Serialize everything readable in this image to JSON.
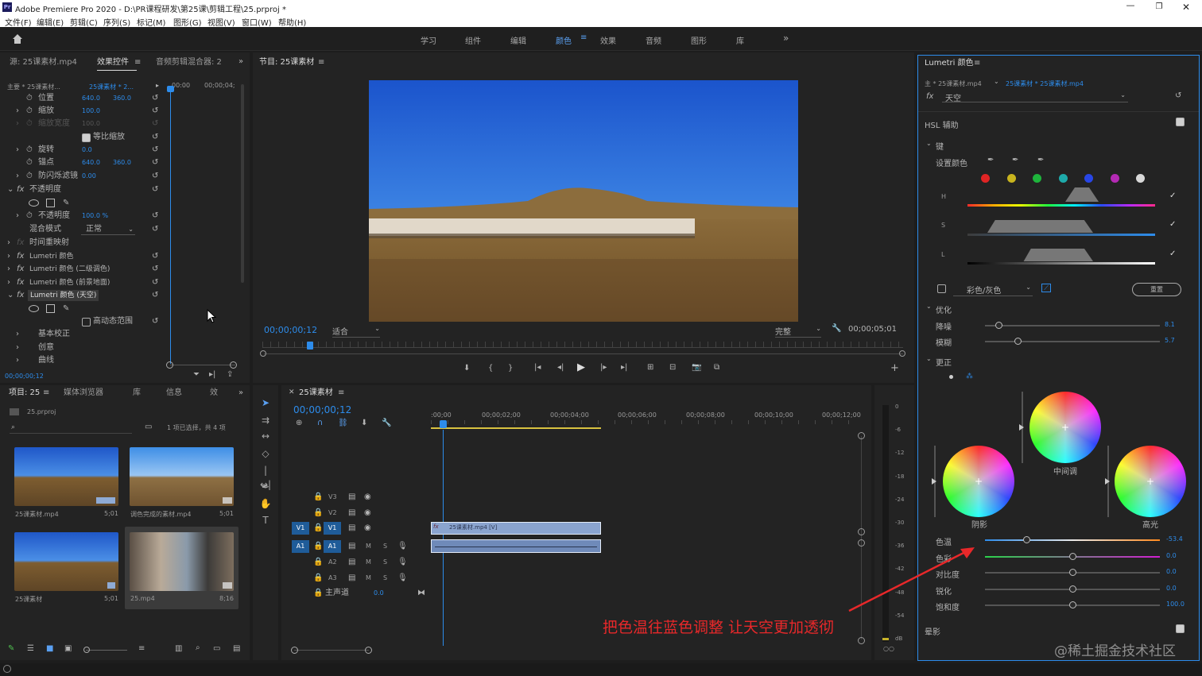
{
  "window": {
    "title": "Adobe Premiere Pro 2020 - D:\\PR课程研发\\第25课\\剪辑工程\\25.prproj *",
    "controls": [
      "minimize",
      "restore",
      "close"
    ]
  },
  "menu": [
    "文件(F)",
    "编辑(E)",
    "剪辑(C)",
    "序列(S)",
    "标记(M)",
    "图形(G)",
    "视图(V)",
    "窗口(W)",
    "帮助(H)"
  ],
  "workspaces": {
    "items": [
      "学习",
      "组件",
      "编辑",
      "颜色",
      "效果",
      "音频",
      "图形",
      "库"
    ],
    "active": "颜色"
  },
  "effect_controls": {
    "tabs": [
      "源: 25课素材.mp4",
      "效果控件",
      "音频剪辑混合器: 2"
    ],
    "active_tab": "效果控件",
    "clip_label": "主要 * 25课素材...",
    "clip_target": "25课素材 * 2...",
    "time_start": "00:00",
    "time_end": "00;00;04;",
    "rows": [
      {
        "name": "位置",
        "v1": "640.0",
        "v2": "360.0"
      },
      {
        "name": "缩放",
        "v1": "100.0",
        "v2": ""
      },
      {
        "name": "缩放宽度",
        "v1": "100.0",
        "v2": ""
      },
      {
        "name": "等比缩放",
        "v1": "",
        "v2": ""
      },
      {
        "name": "旋转",
        "v1": "0.0",
        "v2": ""
      },
      {
        "name": "锚点",
        "v1": "640.0",
        "v2": "360.0"
      },
      {
        "name": "防闪烁滤镜",
        "v1": "0.00",
        "v2": ""
      },
      {
        "name": "不透明度",
        "v1": "",
        "v2": ""
      },
      {
        "name": "不透明度",
        "v1": "100.0 %",
        "v2": ""
      },
      {
        "name": "混合模式",
        "v1": "正常",
        "v2": ""
      },
      {
        "name": "时间重映射",
        "v1": "",
        "v2": ""
      },
      {
        "name": "Lumetri 颜色",
        "v1": "",
        "v2": ""
      },
      {
        "name": "Lumetri 颜色 (二级调色)",
        "v1": "",
        "v2": ""
      },
      {
        "name": "Lumetri 颜色 (前景地面)",
        "v1": "",
        "v2": ""
      },
      {
        "name": "Lumetri 颜色 (天空)",
        "v1": "",
        "v2": ""
      },
      {
        "name": "高动态范围",
        "v1": "",
        "v2": ""
      },
      {
        "name": "基本校正",
        "v1": "",
        "v2": ""
      },
      {
        "name": "创意",
        "v1": "",
        "v2": ""
      },
      {
        "name": "曲线",
        "v1": "",
        "v2": ""
      }
    ],
    "timecode": "00;00;00;12"
  },
  "program": {
    "title": "节目: 25课素材",
    "timecode": "00;00;00;12",
    "fit": "适合",
    "quality": "完整",
    "duration": "00;00;05;01",
    "playhead_fraction": 0.1
  },
  "project": {
    "tabs": [
      "项目: 25",
      "媒体浏览器",
      "库",
      "信息",
      "效"
    ],
    "file": "25.prproj",
    "selection": "1 项已选择，共 4 项",
    "items": [
      {
        "name": "25课素材.mp4",
        "duration": "5;01"
      },
      {
        "name": "调色完成的素材.mp4",
        "duration": "5;01"
      },
      {
        "name": "25课素材",
        "duration": "5;01"
      },
      {
        "name": "25.mp4",
        "duration": "8;16"
      }
    ]
  },
  "timeline": {
    "title": "25课素材",
    "timecode": "00;00;00;12",
    "ruler": [
      ":00;00",
      "00;00;02;00",
      "00;00;04;00",
      "00;00;06;00",
      "00;00;08;00",
      "00;00;10;00",
      "00;00;12;00"
    ],
    "tracks": [
      {
        "id": "V3",
        "src": ""
      },
      {
        "id": "V2",
        "src": ""
      },
      {
        "id": "V1",
        "src": "V1"
      },
      {
        "id": "A1",
        "src": "A1"
      },
      {
        "id": "A2",
        "src": ""
      },
      {
        "id": "A3",
        "src": ""
      }
    ],
    "master": "主声道",
    "master_value": "0.0",
    "clip_label": "25课素材.mp4 [V]"
  },
  "meter": {
    "labels": [
      "0",
      "-6",
      "-12",
      "-18",
      "-24",
      "-30",
      "-36",
      "-42",
      "-48",
      "-54",
      "dB"
    ]
  },
  "lumetri": {
    "title": "Lumetri 颜色",
    "source": "主 * 25课素材.mp4",
    "target": "25课素材 * 25课素材.mp4",
    "preset": "天空",
    "hsl": "HSL 辅助",
    "key": "键",
    "set_color": "设置颜色",
    "swatches": [
      "#e02424",
      "#c8b41e",
      "#1eb43c",
      "#1eaaaa",
      "#2846e6",
      "#b42ab4",
      "#d8d8d8"
    ],
    "hsl_rows": [
      "H",
      "S",
      "L"
    ],
    "color_gray": "彩色/灰色",
    "reset": "重置",
    "refine": "优化",
    "denoise": "降噪",
    "denoise_value": "8.1",
    "blur": "模糊",
    "blur_value": "5.7",
    "correction": "更正",
    "wheels": [
      "中间调",
      "阴影",
      "高光"
    ],
    "sliders": [
      {
        "name": "色温",
        "value": "-53.4",
        "pos": 0.24
      },
      {
        "name": "色彩",
        "value": "0.0",
        "pos": 0.5
      },
      {
        "name": "对比度",
        "value": "0.0",
        "pos": 0.5
      },
      {
        "name": "锐化",
        "value": "0.0",
        "pos": 0.5
      },
      {
        "name": "饱和度",
        "value": "100.0",
        "pos": 0.5
      }
    ],
    "vignette": "晕影"
  },
  "annotation": "把色温往蓝色调整 让天空更加透彻",
  "watermark": "@稀土掘金技术社区",
  "colors": {
    "accent": "#2d8ceb",
    "annotation": "#e8282a",
    "clip": "#8aa4cf"
  }
}
